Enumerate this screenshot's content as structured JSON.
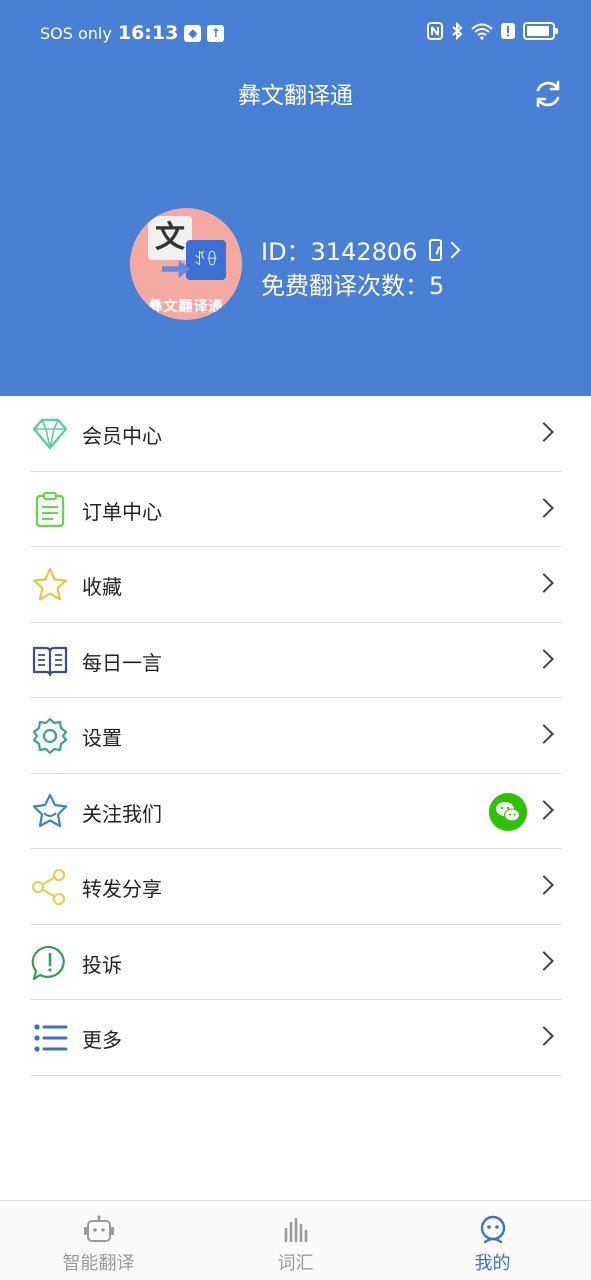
{
  "status_bar": {
    "carrier": "SOS only",
    "time": "16:13"
  },
  "header": {
    "title": "彝文翻译通"
  },
  "user": {
    "avatar_text": "彝文翻译通",
    "avatar_char": "文",
    "avatar_script": "ꀋꂷ",
    "id_label": "ID：3142806",
    "free_count_label": "免费翻译次数：5"
  },
  "menu": {
    "items": [
      {
        "label": "会员中心",
        "icon": "diamond-icon",
        "color": "#5ccf9b"
      },
      {
        "label": "订单中心",
        "icon": "clipboard-icon",
        "color": "#6fcf56"
      },
      {
        "label": "收藏",
        "icon": "star-icon",
        "color": "#e6c64a"
      },
      {
        "label": "每日一言",
        "icon": "book-icon",
        "color": "#3b4d8c"
      },
      {
        "label": "设置",
        "icon": "gear-icon",
        "color": "#3e9fa6"
      },
      {
        "label": "关注我们",
        "icon": "star-badge-icon",
        "color": "#3f85c4"
      },
      {
        "label": "转发分享",
        "icon": "share-icon",
        "color": "#e3d35a"
      },
      {
        "label": "投诉",
        "icon": "complaint-icon",
        "color": "#3f9a55"
      },
      {
        "label": "更多",
        "icon": "list-icon",
        "color": "#3a6fc9"
      }
    ]
  },
  "tabbar": {
    "tabs": [
      {
        "label": "智能翻译",
        "icon": "robot-icon"
      },
      {
        "label": "词汇",
        "icon": "bars-icon"
      },
      {
        "label": "我的",
        "icon": "profile-icon"
      }
    ],
    "active_color": "#3f72cf",
    "inactive_color": "#9a9a9a"
  },
  "colors": {
    "header_bg": "#4a7fd6",
    "avatar_bg": "#f4a9a3"
  }
}
